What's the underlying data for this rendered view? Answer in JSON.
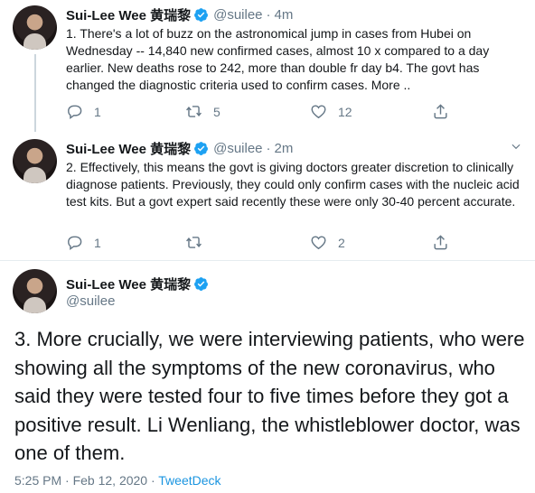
{
  "tweets": [
    {
      "name": "Sui-Lee Wee 黄瑞黎",
      "handle": "@suilee",
      "time": "4m",
      "text": "1. There's a lot of buzz on the astronomical jump in cases from Hubei on Wednesday -- 14,840 new confirmed cases, almost 10 x compared to a day earlier. New deaths rose to 242, more than double fr day b4. The govt has changed the diagnostic criteria used to confirm cases. More ..",
      "reply_count": "1",
      "retweet_count": "5",
      "like_count": "12"
    },
    {
      "name": "Sui-Lee Wee 黄瑞黎",
      "handle": "@suilee",
      "time": "2m",
      "text": "2. Effectively, this means the govt is giving doctors greater discretion to clinically diagnose patients. Previously, they could only confirm cases with the nucleic acid test kits. But a govt expert said recently these were only 30-40 percent accurate.",
      "reply_count": "1",
      "retweet_count": "",
      "like_count": "2"
    }
  ],
  "main_tweet": {
    "name": "Sui-Lee Wee 黄瑞黎",
    "handle": "@suilee",
    "text": "3. More crucially, we were interviewing patients, who were showing all the symptoms of the new coronavirus, who said they were tested four to five times before they got a positive result. Li Wenliang, the whistleblower doctor, was one of them.",
    "timestamp": "5:25 PM · Feb 12, 2020 · ",
    "source": "TweetDeck"
  },
  "separator": "·",
  "colors": {
    "accent": "#1da1f2",
    "muted": "#657786",
    "text": "#14171a"
  },
  "icons": [
    "verified-badge-icon",
    "reply-icon",
    "retweet-icon",
    "like-icon",
    "share-icon",
    "chevron-down-icon"
  ]
}
